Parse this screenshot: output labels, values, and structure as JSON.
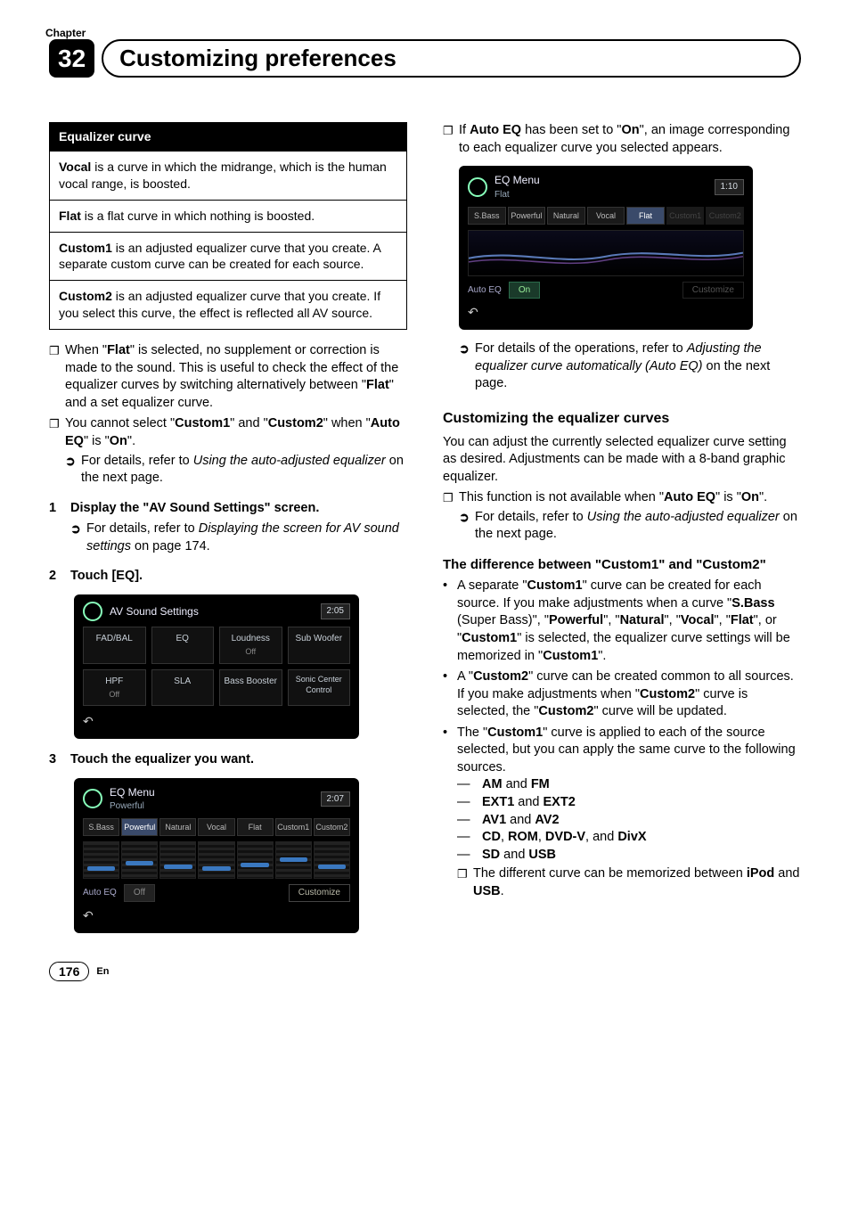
{
  "chapterLabel": "Chapter",
  "chapterNum": "32",
  "title": "Customizing preferences",
  "eqBox": {
    "header": "Equalizer curve",
    "rows": [
      {
        "term": "Vocal",
        "text": " is a curve in which the midrange, which is the human vocal range, is boosted."
      },
      {
        "term": "Flat",
        "text": " is a flat curve in which nothing is boosted."
      },
      {
        "term": "Custom1",
        "text": " is an adjusted equalizer curve that you create. A separate custom curve can be created for each source."
      },
      {
        "term": "Custom2",
        "text": " is an adjusted equalizer curve that you create. If you select this curve, the effect is reflected all AV source."
      }
    ]
  },
  "leftNotes": {
    "n1a": "When \"",
    "n1b": "Flat",
    "n1c": "\" is selected, no supplement or correction is made to the sound. This is useful to check the effect of the equalizer curves by switching alternatively between \"",
    "n1d": "Flat",
    "n1e": "\" and a set equalizer curve.",
    "n2a": "You cannot select \"",
    "n2b": "Custom1",
    "n2c": "\" and \"",
    "n2d": "Custom2",
    "n2e": "\" when \"",
    "n2f": "Auto EQ",
    "n2g": "\" is \"",
    "n2h": "On",
    "n2i": "\".",
    "n2ref1": "For details, refer to ",
    "n2ref2": "Using the auto-adjusted equalizer",
    "n2ref3": " on the next page."
  },
  "steps": {
    "s1num": "1",
    "s1a": "Display the \"AV Sound Settings\" screen.",
    "s1ref1": "For details, refer to ",
    "s1ref2": "Displaying the screen for AV sound settings",
    "s1ref3": " on page 174.",
    "s2num": "2",
    "s2": "Touch [EQ].",
    "s3num": "3",
    "s3": "Touch the equalizer you want."
  },
  "ss1": {
    "title": "AV Sound Settings",
    "time": "2:05",
    "btns": [
      "FAD/BAL",
      "EQ",
      "Loudness",
      "Sub Woofer",
      "HPF",
      "SLA",
      "Bass Booster",
      "Sonic Center Control"
    ],
    "off": "Off"
  },
  "ss2": {
    "title": "EQ Menu",
    "sub": "Powerful",
    "time": "2:07",
    "tabs": [
      "S.Bass",
      "Powerful",
      "Natural",
      "Vocal",
      "Flat",
      "Custom1",
      "Custom2"
    ],
    "autoeq": "Auto EQ",
    "toggle": "Off",
    "customize": "Customize"
  },
  "rightTop": {
    "a": "If ",
    "b": "Auto EQ",
    "c": " has been set to \"",
    "d": "On",
    "e": "\", an image corresponding to each equalizer curve you selected appears."
  },
  "ss3": {
    "title": "EQ Menu",
    "sub": "Flat",
    "time": "1:10",
    "tabs": [
      "S.Bass",
      "Powerful",
      "Natural",
      "Vocal",
      "Flat",
      "Custom1",
      "Custom2"
    ],
    "autoeq": "Auto EQ",
    "toggle": "On",
    "customize": "Customize"
  },
  "rightRef": {
    "a": "For details of the operations, refer to ",
    "b": "Adjusting the equalizer curve automatically (Auto EQ)",
    "c": " on the next page."
  },
  "h2": "Customizing the equalizer curves",
  "p1": "You can adjust the currently selected equalizer curve setting as desired. Adjustments can be made with a 8-band graphic equalizer.",
  "rn1": {
    "a": "This function is not available when \"",
    "b": "Auto EQ",
    "c": "\" is \"",
    "d": "On",
    "e": "\"."
  },
  "rn1ref": {
    "a": "For details, refer to ",
    "b": "Using the auto-adjusted equalizer",
    "c": " on the next page."
  },
  "h3a": "The difference between \"",
  "h3b": "Custom1",
  "h3c": "\" and \"",
  "h3d": "Custom2",
  "h3e": "\"",
  "bl1": {
    "a": "A separate \"",
    "b": "Custom1",
    "c": "\" curve can be created for each source. If you make adjustments when a curve \"",
    "d": "S.Bass",
    "d2": " (Super Bass)\", \"",
    "e": "Powerful",
    "f": "\", \"",
    "g": "Natural",
    "h": "\", \"",
    "i": "Vocal",
    "j": "\", \"",
    "k": "Flat",
    "l": "\", or \"",
    "m": "Custom1",
    "n": "\" is selected, the equalizer curve settings will be memorized in \"",
    "o": "Custom1",
    "p": "\"."
  },
  "bl2": {
    "a": "A \"",
    "b": "Custom2",
    "c": "\" curve can be created common to all sources. If you make adjustments when \"",
    "d": "Custom2",
    "e": "\" curve is selected, the \"",
    "f": "Custom2",
    "g": "\" curve will be updated."
  },
  "bl3": {
    "a": "The \"",
    "b": "Custom1",
    "c": "\" curve is applied to each of the source selected, but you can apply the same curve to the following sources."
  },
  "src": {
    "r1a": "AM",
    "r1and": " and ",
    "r1b": "FM",
    "r2a": "EXT1",
    "r2b": "EXT2",
    "r3a": "AV1",
    "r3b": "AV2",
    "r4a": "CD",
    "r4b": "ROM",
    "r4c": "DVD-V",
    "r4d": "DivX",
    "comma": ", ",
    "and": ", and ",
    "r5a": "SD",
    "r5b": "USB"
  },
  "lastNote": {
    "a": "The different curve can be memorized between ",
    "b": "iPod",
    "c": " and ",
    "d": "USB",
    "e": "."
  },
  "pageNum": "176",
  "en": "En"
}
